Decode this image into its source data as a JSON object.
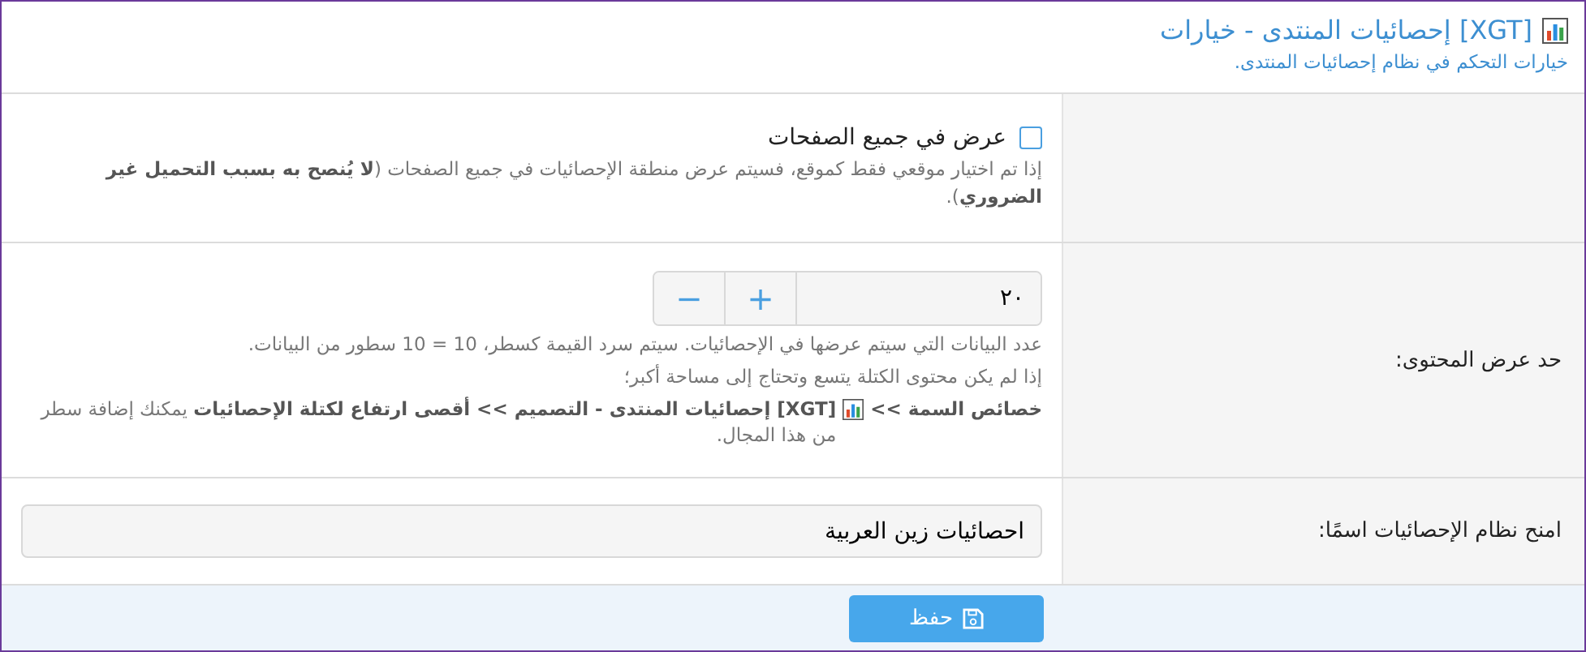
{
  "header": {
    "title": "[XGT] إحصائيات المنتدى - خيارات",
    "subtitle": "خيارات التحكم في نظام إحصائيات المنتدى."
  },
  "rows": [
    {
      "kind": "checkbox",
      "label": "",
      "option": {
        "text": "عرض في جميع الصفحات",
        "checked": false
      },
      "help": [
        "إذا تم اختيار موقعي فقط كموقع، فسيتم عرض منطقة الإحصائيات في جميع الصفحات (**لا يُنصح به بسبب التحميل غير الضروري**)."
      ]
    },
    {
      "kind": "number",
      "label": "حد عرض المحتوى:",
      "value": "٢٠",
      "minus": "−",
      "plus": "+",
      "help": [
        "عدد البيانات التي سيتم عرضها في الإحصائيات. سيتم سرد القيمة كسطر، 10 = 10 سطور من البيانات.",
        "إذا لم يكن محتوى الكتلة يتسع وتحتاج إلى مساحة أكبر؛"
      ],
      "path": {
        "before": "خصائص السمة >>",
        "after": "**[XGT] إحصائيات المنتدى - التصميم >> أقصى ارتفاع لكتلة الإحصائيات** يمكنك إضافة سطر من هذا المجال."
      }
    },
    {
      "kind": "text",
      "label": "امنح نظام الإحصائيات اسمًا:",
      "value": "احصائيات زين العربية"
    }
  ],
  "footer": {
    "save": "حفظ"
  }
}
